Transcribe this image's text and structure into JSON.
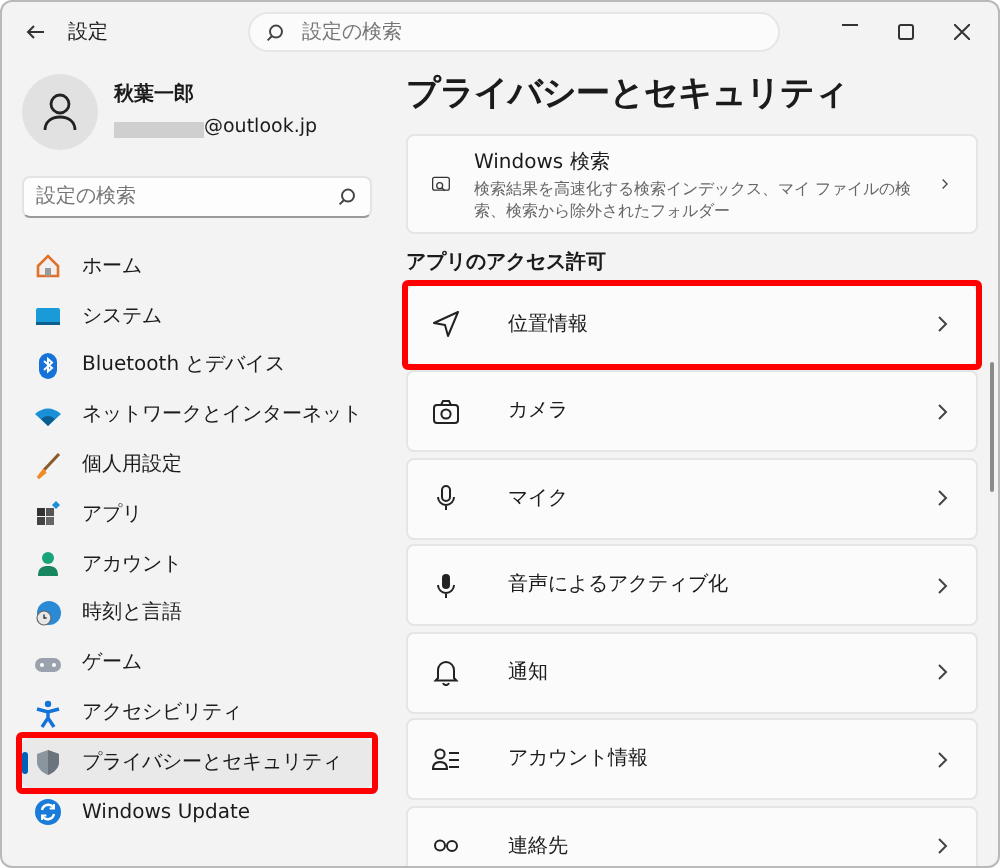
{
  "window": {
    "title": "設定",
    "search_placeholder": "設定の検索"
  },
  "user": {
    "name": "秋葉一郎",
    "email": "@outlook.jp"
  },
  "sidebar": {
    "search_placeholder": "設定の検索",
    "items": [
      {
        "label": "ホーム",
        "kind": "home",
        "selected": false,
        "highlighted": false
      },
      {
        "label": "システム",
        "kind": "system",
        "selected": false,
        "highlighted": false
      },
      {
        "label": "Bluetooth とデバイス",
        "kind": "bluetooth",
        "selected": false,
        "highlighted": false
      },
      {
        "label": "ネットワークとインターネット",
        "kind": "wifi",
        "selected": false,
        "highlighted": false
      },
      {
        "label": "個人用設定",
        "kind": "brush",
        "selected": false,
        "highlighted": false
      },
      {
        "label": "アプリ",
        "kind": "apps",
        "selected": false,
        "highlighted": false
      },
      {
        "label": "アカウント",
        "kind": "person",
        "selected": false,
        "highlighted": false
      },
      {
        "label": "時刻と言語",
        "kind": "globe",
        "selected": false,
        "highlighted": false
      },
      {
        "label": "ゲーム",
        "kind": "gamepad",
        "selected": false,
        "highlighted": false
      },
      {
        "label": "アクセシビリティ",
        "kind": "accessibility",
        "selected": false,
        "highlighted": false
      },
      {
        "label": "プライバシーとセキュリティ",
        "kind": "shield",
        "selected": true,
        "highlighted": true
      },
      {
        "label": "Windows Update",
        "kind": "update",
        "selected": false,
        "highlighted": false
      }
    ]
  },
  "page": {
    "title": "プライバシーとセキュリティ",
    "top_card": {
      "title": "Windows 検索",
      "description": "検索結果を高速化する検索インデックス、マイ ファイルの検索、検索から除外されたフォルダー"
    },
    "section": "アプリのアクセス許可",
    "rows": [
      {
        "label": "位置情報",
        "kind": "location",
        "highlighted": true
      },
      {
        "label": "カメラ",
        "kind": "camera",
        "highlighted": false
      },
      {
        "label": "マイク",
        "kind": "mic",
        "highlighted": false
      },
      {
        "label": "音声によるアクティブ化",
        "kind": "voice",
        "highlighted": false
      },
      {
        "label": "通知",
        "kind": "bell",
        "highlighted": false
      },
      {
        "label": "アカウント情報",
        "kind": "account",
        "highlighted": false
      },
      {
        "label": "連絡先",
        "kind": "contacts",
        "highlighted": false
      }
    ]
  }
}
